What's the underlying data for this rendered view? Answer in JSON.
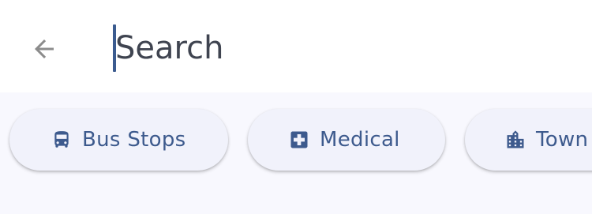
{
  "search": {
    "placeholder": "Search",
    "value": ""
  },
  "header": {
    "back_icon": "arrow-left-icon"
  },
  "chips": [
    {
      "label": "Bus Stops",
      "icon": "bus-icon"
    },
    {
      "label": "Medical",
      "icon": "medical-cross-icon"
    },
    {
      "label": "Town",
      "icon": "building-icon"
    }
  ],
  "colors": {
    "accent": "#3d5a8d",
    "caret": "#3b5b8f",
    "chip_background": "#f1f2fb",
    "chip_area_background": "#f8f8fe",
    "back_icon": "#8c8c8c"
  }
}
